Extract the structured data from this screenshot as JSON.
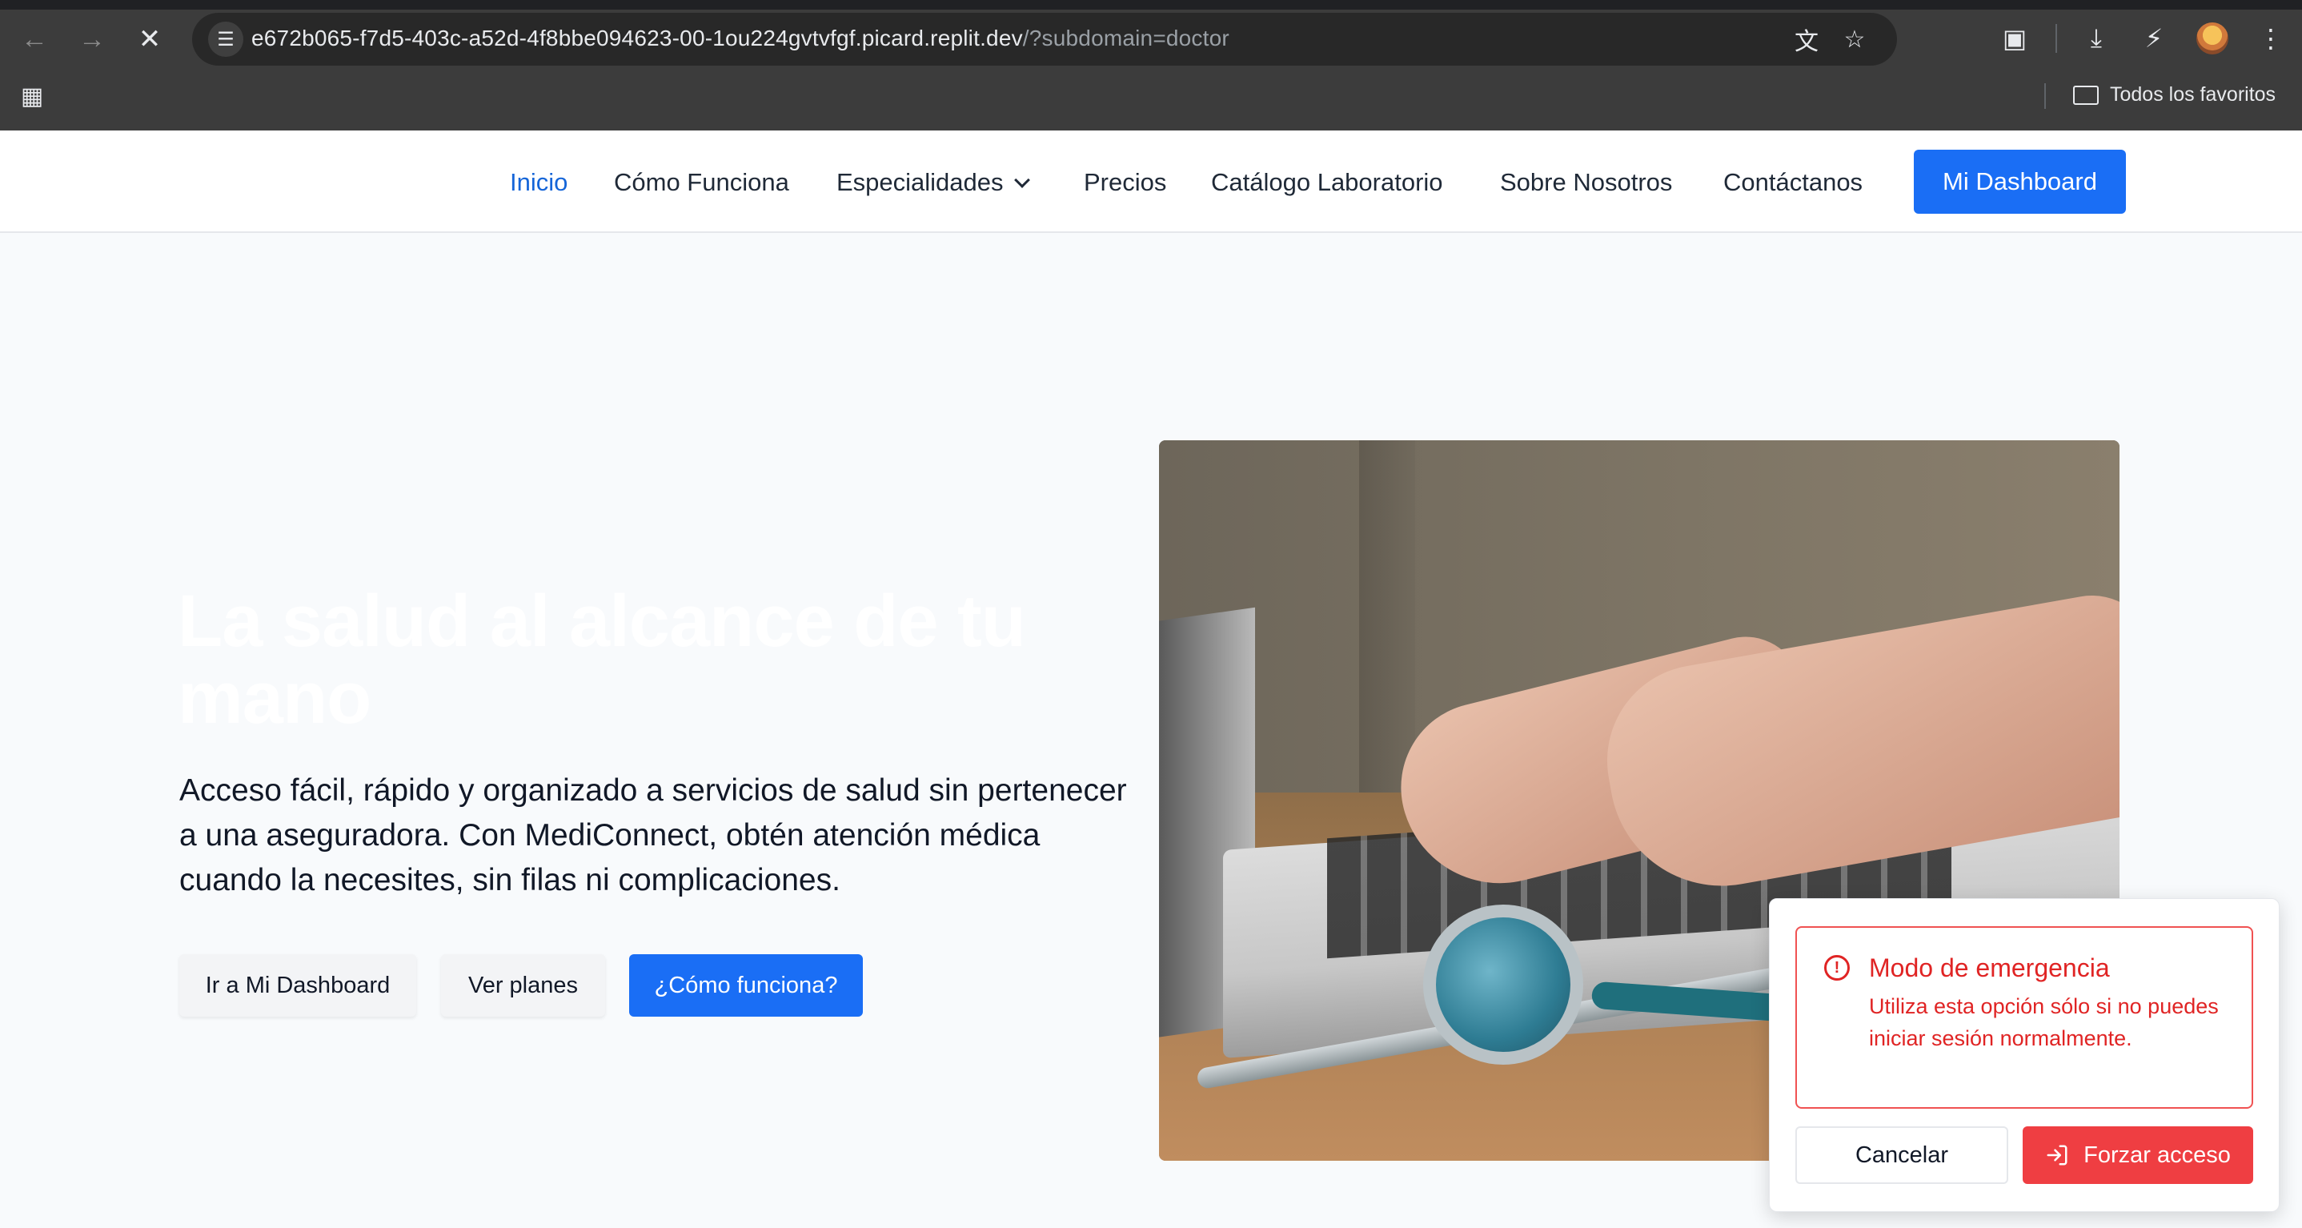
{
  "browser": {
    "url_host": "e672b065-f7d5-403c-a52d-4f8bbe094623-00-1ou224gvtvfgf.picard.replit.dev",
    "url_path": "/?subdomain=doctor",
    "bookmarks_folder": "Todos los favoritos",
    "icons": [
      "back-icon",
      "forward-icon",
      "stop-icon",
      "site-info-icon",
      "translate-icon",
      "star-icon",
      "extensions-icon",
      "download-icon",
      "performance-icon",
      "avatar",
      "menu-icon",
      "apps-icon",
      "folder-icon"
    ]
  },
  "nav": {
    "items": [
      {
        "label": "Inicio",
        "active": true
      },
      {
        "label": "Cómo Funciona"
      },
      {
        "label": "Especialidades"
      },
      {
        "label": "Precios"
      },
      {
        "label": "Catálogo Laboratorio"
      },
      {
        "label": "Sobre Nosotros"
      },
      {
        "label": "Contáctanos"
      }
    ],
    "cta": "Mi Dashboard",
    "accent": "#1a6ef5"
  },
  "hero": {
    "title": "La salud al alcance de tu mano",
    "text": "Acceso fácil, rápido y organizado a servicios de salud sin pertenecer a una aseguradora. Con MediConnect, obtén atención médica cuando la necesites, sin filas ni complicaciones.",
    "buttons": [
      "Ir a Mi Dashboard",
      "Ver planes",
      "¿Cómo funciona?"
    ],
    "image": "hands-typing-laptop-with-stethoscope"
  },
  "popup": {
    "title": "Modo de emergencia",
    "text": "Utiliza esta opción sólo si no puedes iniciar sesión normalmente.",
    "cancel": "Cancelar",
    "force": "Forzar acceso",
    "danger_color": "#ef3e42"
  }
}
